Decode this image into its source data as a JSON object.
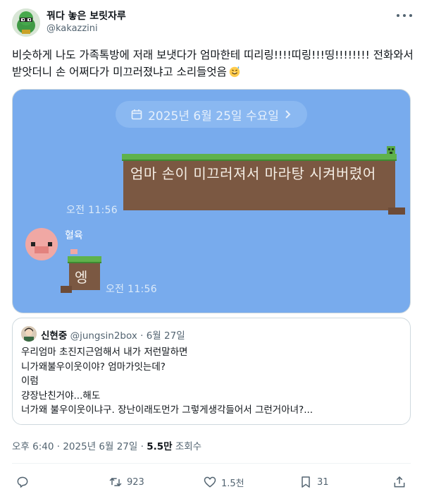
{
  "author": {
    "display_name": "꿔다 놓은 보릿자루",
    "handle": "@kakazzini"
  },
  "tweet": {
    "text": "비슷하게 나도 가족톡방에 저래 보냇다가 엄마한테 띠리링!!!!띠링!!!띵!!!!!!!! 전화와서 받앗더니 손 어쩌다가 미끄러졌냐고 소리들엇음"
  },
  "media": {
    "date_label": "2025년 6월 25일 수요일",
    "message1_text": "엄마 손이 미끄러져서 마라탕 시켜버렸어",
    "message1_time": "오전 11:56",
    "sender_name": "혈육",
    "message2_text": "엥",
    "message2_time": "오전 11:56"
  },
  "quote": {
    "display_name": "신현중",
    "handle": "@jungsin2box",
    "separator": "·",
    "date": "6월 27일",
    "lines": [
      "우리엄마 초진지근엄해서 내가 저런말하면",
      "니가왜불우이웃이야? 엄마가잇는데?",
      "이럼",
      "걍장난친거야...해도",
      "너가왜 불우이웃이냐구. 장난이래도먼가 그렇게생각들어서 그런거아녀?..."
    ]
  },
  "meta": {
    "time": "오후 6:40",
    "separator": "·",
    "date": "2025년 6월 27일",
    "views_count": "5.5만",
    "views_label": "조회수"
  },
  "actions": {
    "reply_count": "",
    "retweet_count": "923",
    "like_count": "1.5천",
    "bookmark_count": "31"
  },
  "colors": {
    "chat_background": "#78abed",
    "dirt": "#7b5842",
    "grass": "#5fb24c",
    "secondary_text": "#536471"
  }
}
